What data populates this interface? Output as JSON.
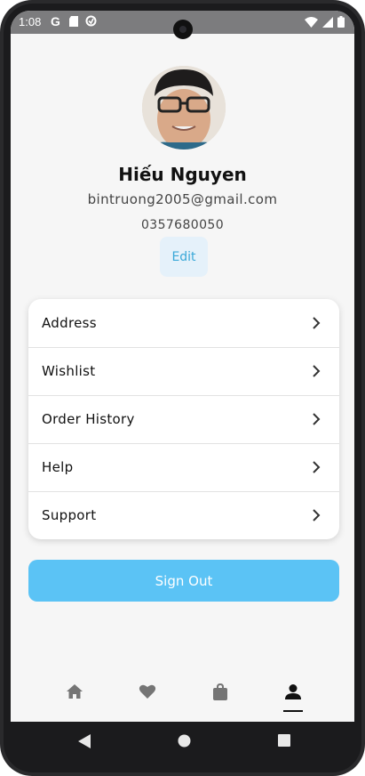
{
  "status_bar": {
    "time": "1:08",
    "left_icons": [
      "google-icon",
      "sd-card-icon",
      "sync-icon"
    ],
    "right_icons": [
      "wifi-icon",
      "signal-icon",
      "battery-icon"
    ]
  },
  "profile": {
    "name": "Hiếu Nguyen",
    "email": "bintruong2005@gmail.com",
    "phone": "0357680050",
    "edit_label": "Edit"
  },
  "menu": {
    "items": [
      {
        "label": "Address"
      },
      {
        "label": "Wishlist"
      },
      {
        "label": "Order History"
      },
      {
        "label": "Help"
      },
      {
        "label": "Support"
      }
    ]
  },
  "sign_out_label": "Sign Out",
  "bottom_nav": {
    "items": [
      "home-icon",
      "heart-icon",
      "shopping-bag-icon",
      "person-icon"
    ],
    "active": "person-icon"
  },
  "colors": {
    "accent": "#5bc3f5",
    "edit_bg": "#e5f1fa",
    "edit_text": "#3aa8d8",
    "nav_icon": "#757575"
  }
}
